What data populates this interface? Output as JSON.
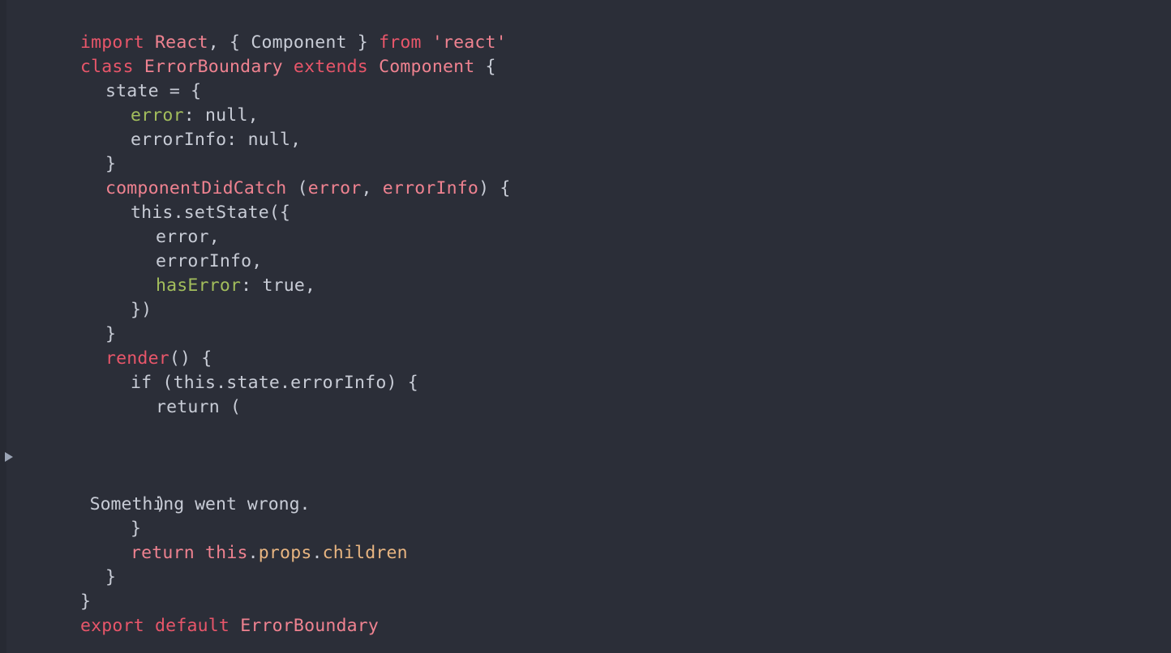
{
  "editor": {
    "background_color": "#2b2e38",
    "gutter_color": "#272a33",
    "font_size_px": 21.5,
    "line_height_px": 30,
    "colors": {
      "keyword": "#e8566a",
      "entity": "#ef8290",
      "string": "#ef8290",
      "property": "#a3be5c",
      "plain": "#c8ccd6",
      "orange": "#e8b581",
      "triangle": "#9aa3b4"
    }
  },
  "code": {
    "language": "jsx",
    "lines": [
      {
        "indent": 0,
        "tokens": [
          {
            "t": "import",
            "c": "keyword"
          },
          {
            "t": " ",
            "c": "plain"
          },
          {
            "t": "React",
            "c": "entity"
          },
          {
            "t": ", { ",
            "c": "plain"
          },
          {
            "t": "Component",
            "c": "plain"
          },
          {
            "t": " } ",
            "c": "plain"
          },
          {
            "t": "from",
            "c": "keyword"
          },
          {
            "t": " ",
            "c": "plain"
          },
          {
            "t": "'react'",
            "c": "string"
          }
        ]
      },
      {
        "indent": 0,
        "tokens": [
          {
            "t": "class",
            "c": "keyword"
          },
          {
            "t": " ",
            "c": "plain"
          },
          {
            "t": "ErrorBoundary",
            "c": "entity"
          },
          {
            "t": " ",
            "c": "plain"
          },
          {
            "t": "extends",
            "c": "keyword"
          },
          {
            "t": " ",
            "c": "plain"
          },
          {
            "t": "Component",
            "c": "entity"
          },
          {
            "t": " {",
            "c": "plain"
          }
        ]
      },
      {
        "indent": 1,
        "tokens": [
          {
            "t": "state = {",
            "c": "plain"
          }
        ]
      },
      {
        "indent": 2,
        "tokens": [
          {
            "t": "error",
            "c": "property"
          },
          {
            "t": ": null,",
            "c": "plain"
          }
        ]
      },
      {
        "indent": 2,
        "tokens": [
          {
            "t": "errorInfo: null,",
            "c": "plain"
          }
        ]
      },
      {
        "indent": 1,
        "tokens": [
          {
            "t": "}",
            "c": "plain"
          }
        ]
      },
      {
        "indent": 1,
        "tokens": [
          {
            "t": "componentDidCatch",
            "c": "entity"
          },
          {
            "t": " (",
            "c": "plain"
          },
          {
            "t": "error",
            "c": "entity"
          },
          {
            "t": ", ",
            "c": "plain"
          },
          {
            "t": "errorInfo",
            "c": "entity"
          },
          {
            "t": ") {",
            "c": "plain"
          }
        ]
      },
      {
        "indent": 2,
        "tokens": [
          {
            "t": "this.setState({",
            "c": "plain"
          }
        ]
      },
      {
        "indent": 3,
        "tokens": [
          {
            "t": "error,",
            "c": "plain"
          }
        ]
      },
      {
        "indent": 3,
        "tokens": [
          {
            "t": "errorInfo,",
            "c": "plain"
          }
        ]
      },
      {
        "indent": 3,
        "tokens": [
          {
            "t": "hasError",
            "c": "property"
          },
          {
            "t": ": true,",
            "c": "plain"
          }
        ]
      },
      {
        "indent": 2,
        "tokens": [
          {
            "t": "})",
            "c": "plain"
          }
        ]
      },
      {
        "indent": 1,
        "tokens": [
          {
            "t": "}",
            "c": "plain"
          }
        ]
      },
      {
        "indent": 1,
        "tokens": [
          {
            "t": "render",
            "c": "keyword"
          },
          {
            "t": "() {",
            "c": "plain"
          }
        ]
      },
      {
        "indent": 2,
        "tokens": [
          {
            "t": "if (this.state.errorInfo) {",
            "c": "plain"
          }
        ]
      },
      {
        "indent": 3,
        "tokens": [
          {
            "t": "return (",
            "c": "plain"
          }
        ]
      }
    ],
    "lines_after": [
      {
        "indent": 3,
        "tokens": [
          {
            "t": ")",
            "c": "plain"
          }
        ]
      },
      {
        "indent": 2,
        "tokens": [
          {
            "t": "}",
            "c": "plain"
          }
        ]
      },
      {
        "indent": 2,
        "tokens": [
          {
            "t": "return",
            "c": "entity"
          },
          {
            "t": " ",
            "c": "plain"
          },
          {
            "t": "this",
            "c": "entity"
          },
          {
            "t": ".",
            "c": "plain"
          },
          {
            "t": "props",
            "c": "orange"
          },
          {
            "t": ".",
            "c": "plain"
          },
          {
            "t": "children",
            "c": "orange"
          }
        ]
      },
      {
        "indent": 1,
        "tokens": [
          {
            "t": "}",
            "c": "plain"
          }
        ]
      },
      {
        "indent": 0,
        "tokens": [
          {
            "t": "}",
            "c": "plain"
          }
        ]
      },
      {
        "indent": 0,
        "tokens": [
          {
            "t": "export",
            "c": "keyword"
          },
          {
            "t": " ",
            "c": "plain"
          },
          {
            "t": "default",
            "c": "keyword"
          },
          {
            "t": " ",
            "c": "plain"
          },
          {
            "t": "ErrorBoundary",
            "c": "entity"
          }
        ]
      }
    ]
  },
  "rendered_output": {
    "triangle_icon": "disclosure-triangle-collapsed",
    "message": "Something went wrong."
  }
}
